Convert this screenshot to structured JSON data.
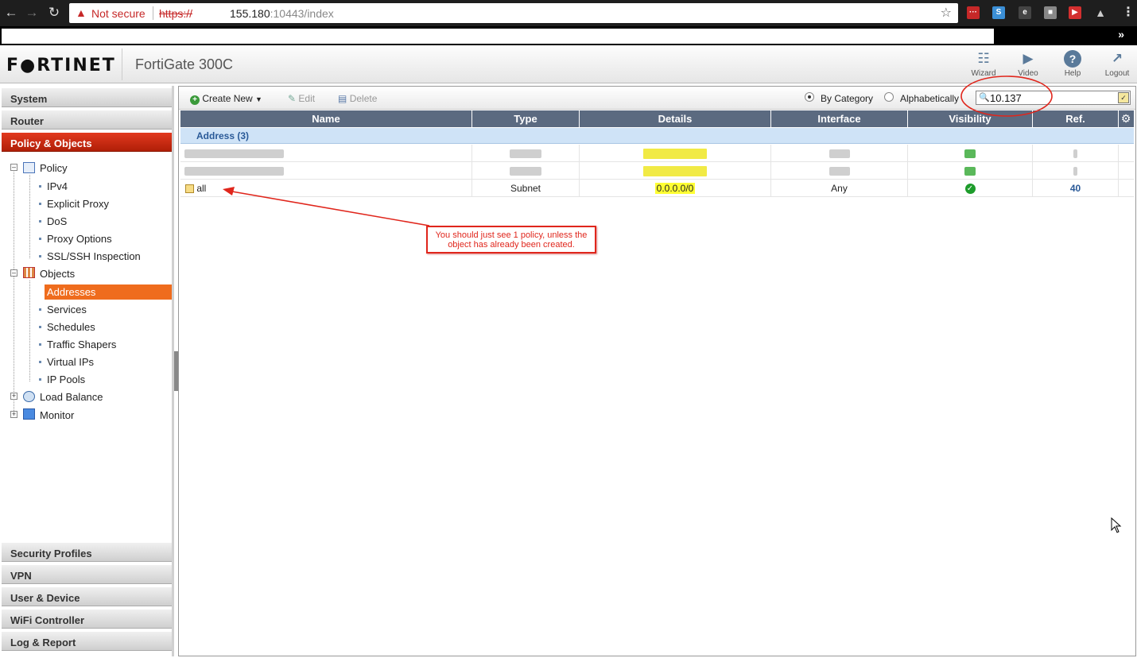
{
  "browser": {
    "not_secure": "Not secure",
    "scheme": "https://",
    "host": "155.180",
    "port_path": ":10443/index",
    "menu": "⋮",
    "bookmark_more": "»"
  },
  "header": {
    "logo": "F●RTINET",
    "product": "FortiGate 300C",
    "buttons": [
      {
        "label": "Wizard",
        "icon": "wizard-icon"
      },
      {
        "label": "Video",
        "icon": "video-icon"
      },
      {
        "label": "Help",
        "icon": "help-icon"
      },
      {
        "label": "Logout",
        "icon": "logout-icon"
      }
    ]
  },
  "sidebar": {
    "categories_top": [
      "System",
      "Router",
      "Policy & Objects"
    ],
    "categories_bottom": [
      "Security Profiles",
      "VPN",
      "User & Device",
      "WiFi Controller",
      "Log & Report"
    ],
    "tree": {
      "policy": "Policy",
      "policy_items": [
        "IPv4",
        "Explicit Proxy",
        "DoS",
        "Proxy Options",
        "SSL/SSH Inspection"
      ],
      "objects": "Objects",
      "object_items": [
        "Addresses",
        "Services",
        "Schedules",
        "Traffic Shapers",
        "Virtual IPs",
        "IP Pools"
      ],
      "load_balance": "Load Balance",
      "monitor": "Monitor"
    }
  },
  "toolbar": {
    "create_new": "Create New",
    "edit": "Edit",
    "delete": "Delete",
    "by_category": "By Category",
    "alphabetically": "Alphabetically",
    "search_value": "10.137"
  },
  "table": {
    "columns": [
      "Name",
      "Type",
      "Details",
      "Interface",
      "Visibility",
      "Ref."
    ],
    "group": "Address (3)",
    "rows": [
      {
        "name": "",
        "type": "",
        "details": "",
        "interface": "",
        "visibility": "",
        "ref": "",
        "redacted": true
      },
      {
        "name": "",
        "type": "",
        "details": "",
        "interface": "",
        "visibility": "",
        "ref": "",
        "redacted": true
      },
      {
        "name": "all",
        "type": "Subnet",
        "details": "0.0.0.0/0",
        "interface": "Any",
        "visibility": "enabled",
        "ref": "40"
      }
    ]
  },
  "annotation": {
    "text": "You should just see 1 policy, unless the object has already been created.",
    "color": "#e0261c"
  },
  "colors": {
    "brand_red": "#c8290e",
    "selected_orange": "#ef6c1d",
    "grid_header": "#5b6a80",
    "group_row": "#cfe3f7"
  }
}
